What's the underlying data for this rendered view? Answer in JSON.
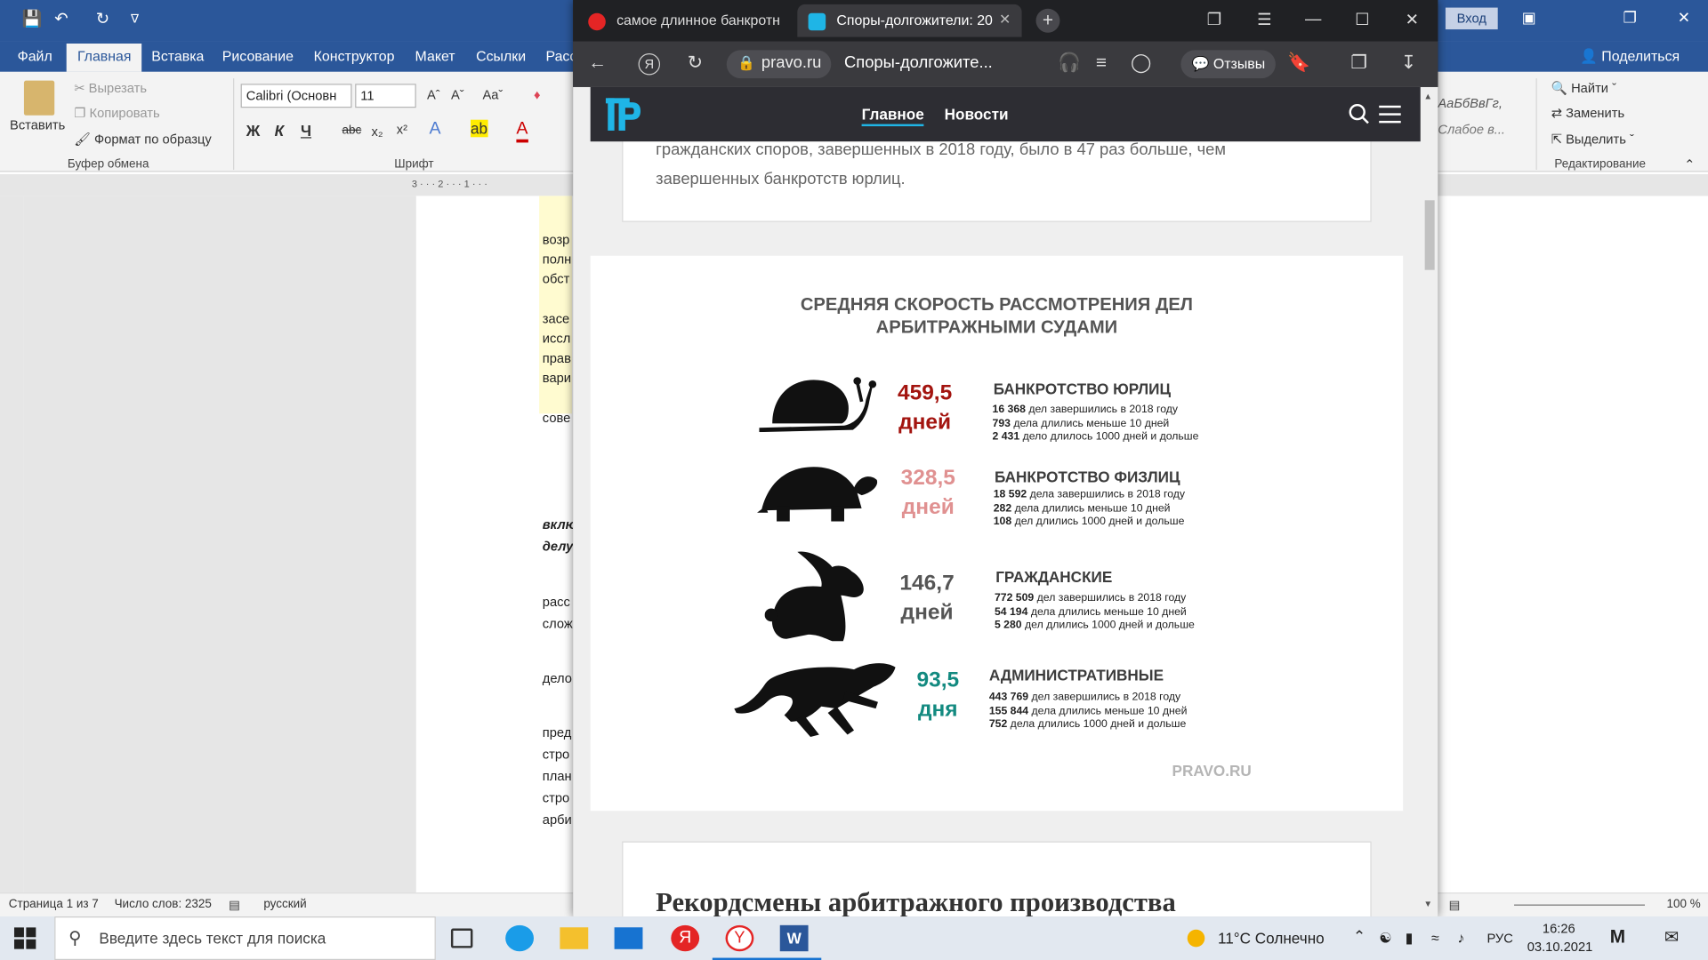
{
  "word": {
    "tabs": [
      "Файл",
      "Главная",
      "Вставка",
      "Рисование",
      "Конструктор",
      "Макет",
      "Ссылки",
      "Расс"
    ],
    "active_tab": "Главная",
    "login_label": "Вход",
    "share_label": "Поделиться",
    "clipboard": {
      "paste": "Вставить",
      "cut": "Вырезать",
      "copy": "Копировать",
      "format_painter": "Формат по образцу",
      "group": "Буфер обмена"
    },
    "font": {
      "name": "Calibri (Основн",
      "size": "11",
      "group": "Шрифт"
    },
    "styles": {
      "style1": "АаБбВвГг,",
      "style2": "Слабое в..."
    },
    "editing": {
      "find": "Найти",
      "replace": "Заменить",
      "select": "Выделить",
      "group": "Редактирование"
    },
    "page_fragments": [
      "возр",
      "полн",
      "обст",
      "засе",
      "иссл",
      "прав",
      "вари",
      "сове",
      "вклю",
      "делу",
      "расс",
      "слож",
      "дело",
      "пред",
      "стро",
      "план",
      "стро",
      "арби"
    ],
    "status": {
      "page": "Страница 1 из 7",
      "words": "Число слов: 2325",
      "lang": "русский",
      "zoom": "100 %"
    }
  },
  "browser": {
    "tab1_title": "самое длинное банкротн",
    "tab2_title": "Споры-долгожители: 20",
    "host": "pravo.ru",
    "page_title": "Споры-долгожите...",
    "reviews_label": "Отзывы"
  },
  "site": {
    "nav": {
      "main": "Главное",
      "news": "Новости"
    },
    "intro_text": "гражданских споров, завершенных в 2018 году, было в 47 раз больше, чем завершенных банкротств юрлиц.",
    "section_heading": "Рекордсмены арбитражного производства"
  },
  "infographic": {
    "title_line1": "СРЕДНЯЯ СКОРОСТЬ РАССМОТРЕНИЯ ДЕЛ",
    "title_line2": "АРБИТРАЖНЫМИ СУДАМИ",
    "watermark": "PRAVO.RU",
    "rows": [
      {
        "value": "459,5",
        "unit": "дней",
        "category": "БАНКРОТСТВО ЮРЛИЦ",
        "color": "#a3140f",
        "lines": [
          {
            "n": "16 368",
            "t": " дел завершились в 2018 году"
          },
          {
            "n": "793",
            "t": " дела длились меньше 10 дней"
          },
          {
            "n": "2 431",
            "t": " дело длилось 1000 дней и дольше"
          }
        ]
      },
      {
        "value": "328,5",
        "unit": "дней",
        "category": "БАНКРОТСТВО ФИЗЛИЦ",
        "color": "#e09191",
        "lines": [
          {
            "n": "18 592",
            "t": " дела завершились в 2018 году"
          },
          {
            "n": "282",
            "t": " дела длились меньше 10 дней"
          },
          {
            "n": "108",
            "t": " дел длились 1000 дней и дольше"
          }
        ]
      },
      {
        "value": "146,7",
        "unit": "дней",
        "category": "ГРАЖДАНСКИЕ",
        "color": "#555555",
        "lines": [
          {
            "n": "772 509",
            "t": " дел завершились в 2018 году"
          },
          {
            "n": "54 194",
            "t": " дела длились меньше 10 дней"
          },
          {
            "n": "5 280",
            "t": " дел длились 1000 дней и дольше"
          }
        ]
      },
      {
        "value": "93,5",
        "unit": "дня",
        "category": "АДМИНИСТРАТИВНЫЕ",
        "color": "#138a80",
        "lines": [
          {
            "n": "443 769",
            "t": " дел завершились в 2018 году"
          },
          {
            "n": "155 844",
            "t": " дела длились меньше 10 дней"
          },
          {
            "n": "752",
            "t": " дела длились 1000 дней и дольше"
          }
        ]
      }
    ]
  },
  "taskbar": {
    "search_placeholder": "Введите здесь текст для поиска",
    "weather": "11°C Солнечно",
    "lang": "РУС",
    "time": "16:26",
    "date": "03.10.2021"
  }
}
